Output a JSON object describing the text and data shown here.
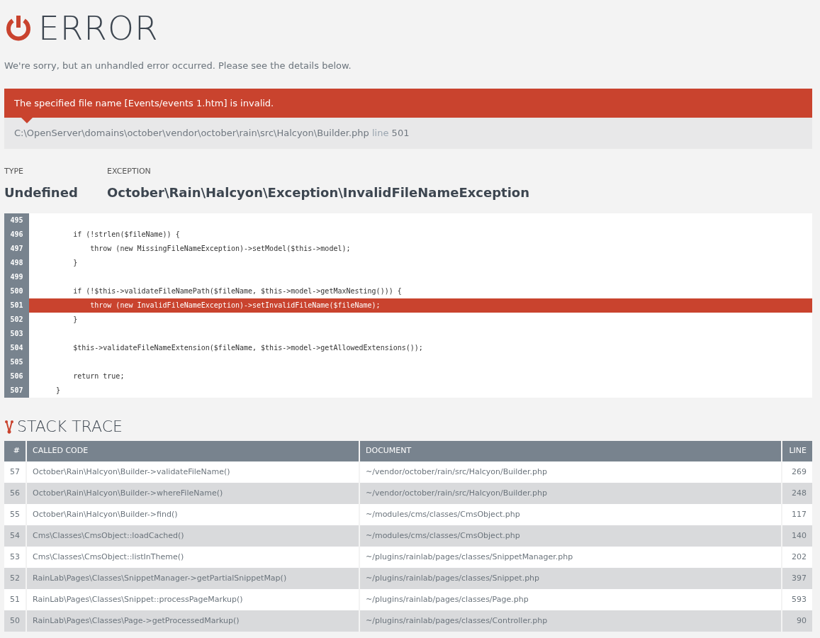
{
  "title": "ERROR",
  "intro": "We're sorry, but an unhandled error occurred. Please see the details below.",
  "error": {
    "message": "The specified file name [Events/events 1.htm] is invalid.",
    "file": "C:\\OpenServer\\domains\\october\\vendor\\october\\rain\\src\\Halcyon\\Builder.php",
    "line_label": "line",
    "line": "501"
  },
  "details": [
    {
      "label": "TYPE",
      "value": "Undefined"
    },
    {
      "label": "EXCEPTION",
      "value": "October\\Rain\\Halcyon\\Exception\\InvalidFileNameException"
    }
  ],
  "code": [
    {
      "number": "495",
      "highlighted": false
    },
    {
      "number": "496",
      "text": "        if (!strlen($fileName)) {",
      "highlighted": false
    },
    {
      "number": "497",
      "text": "            throw (new MissingFileNameException)->setModel($this->model);",
      "highlighted": false
    },
    {
      "number": "498",
      "text": "        }",
      "highlighted": false
    },
    {
      "number": "499",
      "highlighted": false
    },
    {
      "number": "500",
      "text": "        if (!$this->validateFileNamePath($fileName, $this->model->getMaxNesting())) {",
      "highlighted": false
    },
    {
      "number": "501",
      "text": "            throw (new InvalidFileNameException)->setInvalidFileName($fileName);",
      "highlighted": true
    },
    {
      "number": "502",
      "text": "        }",
      "highlighted": false
    },
    {
      "number": "503",
      "highlighted": false
    },
    {
      "number": "504",
      "text": "        $this->validateFileNameExtension($fileName, $this->model->getAllowedExtensions());",
      "highlighted": false
    },
    {
      "number": "505",
      "highlighted": false
    },
    {
      "number": "506",
      "text": "        return true;",
      "highlighted": false
    },
    {
      "number": "507",
      "text": "    }",
      "highlighted": false
    }
  ],
  "stack_trace": {
    "title": "STACK TRACE",
    "columns": [
      "#",
      "CALLED CODE",
      "DOCUMENT",
      "LINE"
    ],
    "rows": [
      [
        "57",
        "October\\Rain\\Halcyon\\Builder->validateFileName()",
        "~/vendor/october/rain/src/Halcyon/Builder.php",
        "269"
      ],
      [
        "56",
        "October\\Rain\\Halcyon\\Builder->whereFileName()",
        "~/vendor/october/rain/src/Halcyon/Builder.php",
        "248"
      ],
      [
        "55",
        "October\\Rain\\Halcyon\\Builder->find()",
        "~/modules/cms/classes/CmsObject.php",
        "117"
      ],
      [
        "54",
        "Cms\\Classes\\CmsObject::loadCached()",
        "~/modules/cms/classes/CmsObject.php",
        "140"
      ],
      [
        "53",
        "Cms\\Classes\\CmsObject::listInTheme()",
        "~/plugins/rainlab/pages/classes/SnippetManager.php",
        "202"
      ],
      [
        "52",
        "RainLab\\Pages\\Classes\\SnippetManager->getPartialSnippetMap()",
        "~/plugins/rainlab/pages/classes/Snippet.php",
        "397"
      ],
      [
        "51",
        "RainLab\\Pages\\Classes\\Snippet::processPageMarkup()",
        "~/plugins/rainlab/pages/classes/Page.php",
        "593"
      ],
      [
        "50",
        "RainLab\\Pages\\Classes\\Page->getProcessedMarkup()",
        "~/plugins/rainlab/pages/classes/Controller.php",
        "90"
      ]
    ]
  }
}
